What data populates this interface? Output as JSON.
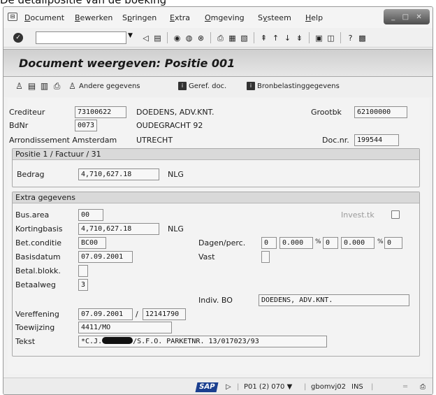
{
  "caption": "De detailpositie van de boeking",
  "menu": {
    "items": [
      "Document",
      "Bewerken",
      "Springen",
      "Extra",
      "Omgeving",
      "Systeem",
      "Help"
    ],
    "underlines": [
      "D",
      "B",
      "p",
      "E",
      "O",
      "y",
      "H"
    ]
  },
  "toolbar": {
    "command_value": "",
    "icons": [
      "enter-icon",
      "back-icon",
      "save-icon",
      "back-nav-icon",
      "exit-icon",
      "cancel-icon",
      "print-icon",
      "find-icon",
      "find-next-icon",
      "first-page-icon",
      "prev-page-icon",
      "next-page-icon",
      "last-page-icon",
      "new-session-icon",
      "shortcut-icon",
      "help-icon",
      "layout-icon"
    ]
  },
  "title": "Document weergeven: Positie 001",
  "app_toolbar": {
    "andere_gegevens": "Andere gegevens",
    "geref_doc": "Geref. doc.",
    "bronbelasting": "Bronbelastinggegevens"
  },
  "header": {
    "crediteur_label": "Crediteur",
    "crediteur_value": "73100622",
    "crediteur_name": "DOEDENS, ADV.KNT.",
    "grootbk_label": "Grootbk",
    "grootbk_value": "62100000",
    "bdnr_label": "BdNr",
    "bdnr_value": "0073",
    "street": "OUDEGRACHT 92",
    "arrond_label": "Arrondissement Amsterdam",
    "city": "UTRECHT",
    "docnr_label": "Doc.nr.",
    "docnr_value": "199544"
  },
  "positie": {
    "title": "Positie 1 / Factuur / 31",
    "bedrag_label": "Bedrag",
    "bedrag_value": "4,710,627.18",
    "currency": "NLG"
  },
  "extra": {
    "title": "Extra gegevens",
    "busarea_label": "Bus.area",
    "busarea_value": "00",
    "invest_label": "Invest.tk",
    "kortingbasis_label": "Kortingbasis",
    "kortingbasis_value": "4,710,627.18",
    "kortingbasis_currency": "NLG",
    "betconditie_label": "Bet.conditie",
    "betconditie_value": "BC00",
    "dagen_label": "Dagen/perc.",
    "dagen1": "0",
    "perc1": "0.000",
    "dagen2": "0",
    "perc2": "0.000",
    "dagen3": "0",
    "pct_sign": "%",
    "basisdatum_label": "Basisdatum",
    "basisdatum_value": "07.09.2001",
    "vast_label": "Vast",
    "betalblokk_label": "Betal.blokk.",
    "betalblokk_value": "",
    "betaalweg_label": "Betaalweg",
    "betaalweg_value": "3",
    "indivbo_label": "Indiv. BO",
    "indivbo_value": "DOEDENS, ADV.KNT.",
    "vereffening_label": "Vereffening",
    "vereffening_date": "07.09.2001",
    "vereffening_sep": "/",
    "vereffening_doc": "12141790",
    "toewijzing_label": "Toewijzing",
    "toewijzing_value": "4411/MO",
    "tekst_label": "Tekst",
    "tekst_prefix": "*C.J.",
    "tekst_suffix": "/S.F.O. PARKETNR. 13/017023/93"
  },
  "status": {
    "logo": "SAP",
    "system": "P01 (2) 070",
    "host": "gbomvj02",
    "mode": "INS"
  }
}
